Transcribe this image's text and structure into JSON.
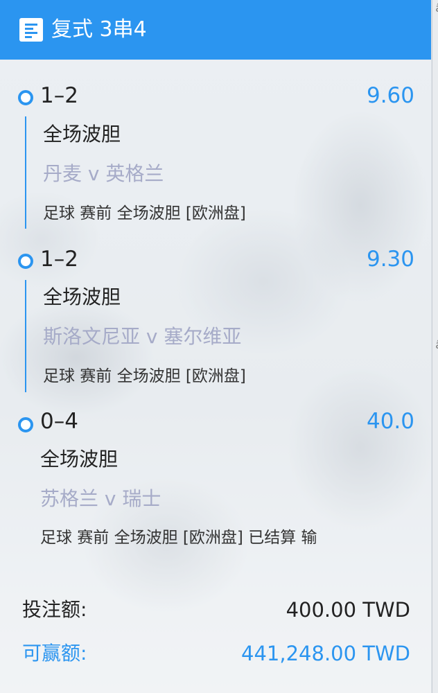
{
  "header": {
    "title": "复式 3串4",
    "icon": "bet-slip-icon",
    "color": "#2b95f0"
  },
  "legs": [
    {
      "score": "1–2",
      "odds": "9.60",
      "market": "全场波胆",
      "teams": "丹麦 v 英格兰",
      "meta": "足球 赛前   全场波胆 [欧洲盘]"
    },
    {
      "score": "1–2",
      "odds": "9.30",
      "market": "全场波胆",
      "teams": "斯洛文尼亚 v 塞尔维亚",
      "meta": "足球 赛前   全场波胆 [欧洲盘]"
    },
    {
      "score": "0–4",
      "odds": "40.0",
      "market": "全场波胆",
      "teams": "苏格兰 v 瑞士",
      "meta": "足球 赛前   全场波胆 [欧洲盘] 已结算 输"
    }
  ],
  "totals": {
    "stake_label": "投注额:",
    "stake_value": "400.00 TWD",
    "win_label": "可赢额:",
    "win_value": "441,248.00 TWD"
  },
  "colors": {
    "accent": "#2b95f0",
    "teams": "#a6abc8"
  }
}
